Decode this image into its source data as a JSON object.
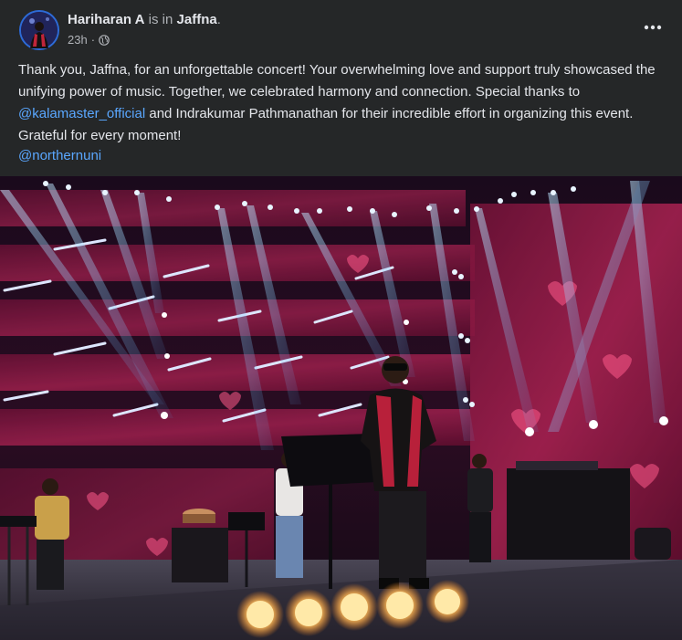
{
  "post": {
    "author": "Hariharan A",
    "is_in": "is in",
    "location": "Jaffna",
    "period": ".",
    "time": "23h",
    "dot": "·",
    "privacy_icon": "globe-icon",
    "more_icon": "more-horizontal-icon",
    "caption": {
      "part1": "Thank you, Jaffna, for an unforgettable concert! Your overwhelming love and support truly showcased the unifying power of music. Together, we celebrated harmony and connection. Special thanks to ",
      "mention": "@kalamaster_official",
      "part2": " and Indrakumar Pathmanathan for their incredible effort in organizing this event. Grateful for every moment!"
    },
    "tag": "@northernuni"
  },
  "colors": {
    "background": "#252728",
    "text": "#e4e6eb",
    "secondary_text": "#b0b3b8",
    "link": "#5aa7ff"
  }
}
